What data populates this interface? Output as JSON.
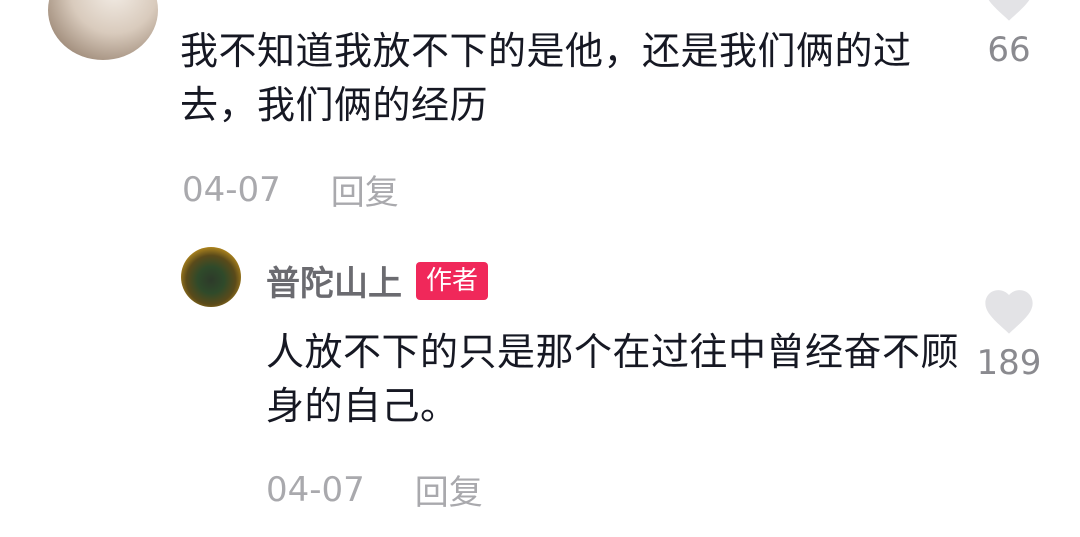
{
  "comment": {
    "text": "我不知道我放不下的是他，还是我们俩的过去，我们俩的经历",
    "date": "04-07",
    "reply_label": "回复",
    "likes": "66"
  },
  "reply": {
    "username": "普陀山上",
    "badge": "作者",
    "text": "人放不下的只是那个在过往中曾经奋不顾身的自己。",
    "date": "04-07",
    "reply_label": "回复",
    "likes": "189"
  },
  "colors": {
    "badge_bg": "#f0285a",
    "meta_text": "#a9a9ad",
    "heart": "#e3e3e6"
  }
}
